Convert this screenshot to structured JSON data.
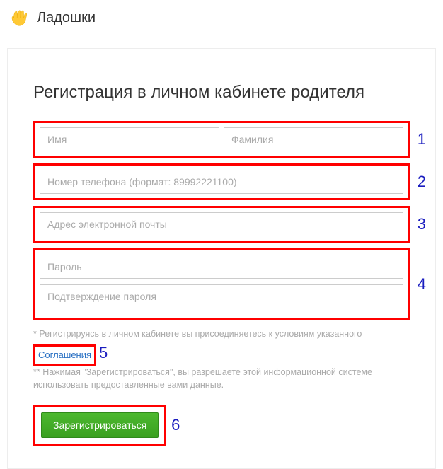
{
  "header": {
    "logo_text": "Ладошки"
  },
  "page": {
    "title": "Регистрация в личном кабинете родителя"
  },
  "form": {
    "first_name_placeholder": "Имя",
    "last_name_placeholder": "Фамилия",
    "phone_placeholder": "Номер телефона (формат: 89992221100)",
    "email_placeholder": "Адрес электронной почты",
    "password_placeholder": "Пароль",
    "password_confirm_placeholder": "Подтверждение пароля",
    "submit_label": "Зарегистрироваться"
  },
  "disclaimer": {
    "line1_prefix": "* Регистрируясь в личном кабинете вы присоединяетесь к условиям указанного ",
    "agreement_link": "Соглашения",
    "line2": "** Нажимая \"Зарегистрироваться\", вы разрешаете этой информационной системе использовать предоставленные вами данные."
  },
  "annotations": {
    "a1": "1",
    "a2": "2",
    "a3": "3",
    "a4": "4",
    "a5": "5",
    "a6": "6"
  }
}
